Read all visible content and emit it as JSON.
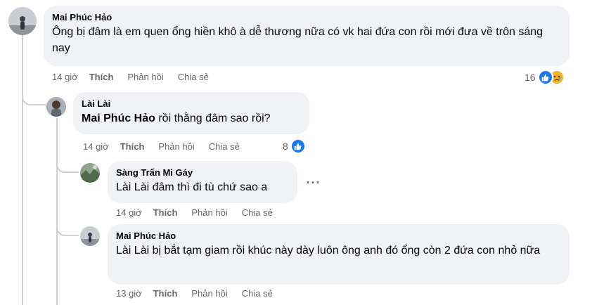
{
  "comments": [
    {
      "author": "Mai Phúc Hảo",
      "text": "Ông bị đâm là em quen ổng hiền khô à dễ thương nữa có vk hai đứa con rồi mới đưa về trôn sáng nay",
      "time": "14 giờ",
      "like_label": "Thích",
      "reply_label": "Phản hồi",
      "share_label": "Chia sẻ",
      "reaction_count": "16",
      "reactions": [
        "like-icon",
        "sad-icon"
      ]
    },
    {
      "author": "Lài Lài",
      "mention": "Mai Phúc Hảo",
      "text": " rồi thằng đâm sao rồi?",
      "time": "14 giờ",
      "like_label": "Thích",
      "reply_label": "Phản hồi",
      "share_label": "Chia sẻ",
      "reaction_count": "8",
      "reactions": [
        "like-icon"
      ]
    },
    {
      "author": "Sàng Trấn Mi Gáy",
      "text": "Lài Lài đâm thì đi tù chứ sao a",
      "time": "14 giờ",
      "like_label": "Thích",
      "reply_label": "Phản hồi",
      "share_label": "Chia sẻ",
      "more_label": "···"
    },
    {
      "author": "Mai Phúc Hảo",
      "text": "Lài Lài bị bắt tạm giam rồi khúc này dày luôn ông anh đó ổng còn 2 đứa con nhỏ nữa",
      "time": "13 giờ",
      "like_label": "Thích",
      "reply_label": "Phản hồi",
      "share_label": "Chia sẻ"
    }
  ],
  "colors": {
    "bubble": "#f0f2f5",
    "meta": "#65676b",
    "like": "#1877f2",
    "sad": "#f7b125",
    "thread": "#ccd0d5"
  }
}
